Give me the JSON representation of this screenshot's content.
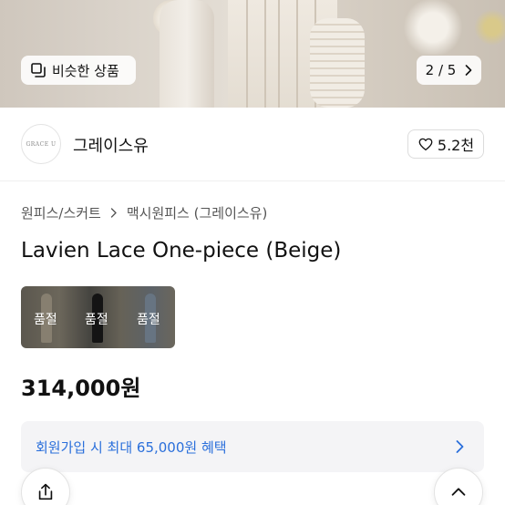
{
  "gallery": {
    "similar_label": "비슷한 상품",
    "page_indicator": "2 / 5"
  },
  "shop": {
    "logo_text": "GRACE U",
    "name": "그레이스유",
    "like_count": "5.2천"
  },
  "breadcrumb": {
    "category": "원피스/스커트",
    "subcategory": "맥시원피스 (그레이스유)"
  },
  "product": {
    "title": "Lavien Lace One-piece (Beige)",
    "price": "314,000원",
    "options": [
      {
        "status": "품절"
      },
      {
        "status": "품절"
      },
      {
        "status": "품절"
      }
    ]
  },
  "promo": {
    "text": "회원가입 시 최대 65,000원 혜택"
  },
  "colors": {
    "accent_blue": "#2a6fdb",
    "promo_bg": "#f4f4f6"
  }
}
